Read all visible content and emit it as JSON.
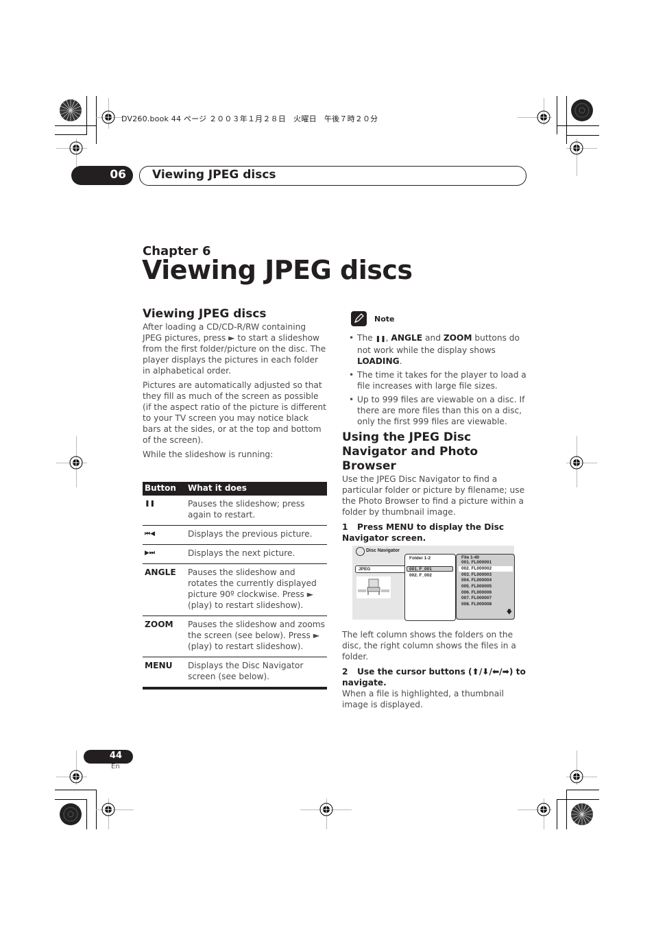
{
  "print_meta": "DV260.book  44 ページ  ２００３年１月２８日　火曜日　午後７時２０分",
  "header": {
    "chapter_number": "06",
    "section_title": "Viewing JPEG discs"
  },
  "chapter_label": "Chapter 6",
  "page_title": "Viewing JPEG discs",
  "left_column": {
    "heading": "Viewing JPEG discs",
    "paragraphs": [
      "After loading a CD/CD-R/RW containing JPEG pictures, press ► to start a slideshow from the first folder/picture on the disc. The player displays the pictures in each folder in alphabetical order.",
      "Pictures are automatically adjusted so that they fill as much of the screen as possible (if the aspect ratio of the picture is different to your TV screen you may notice black bars at the sides, or at the top and bottom of the screen).",
      "While the slideshow is running:"
    ]
  },
  "table": {
    "headers": [
      "Button",
      "What it does"
    ],
    "rows": [
      {
        "button": "❚❚",
        "description": "Pauses the slideshow; press again to restart."
      },
      {
        "button": "⏮◀",
        "description": "Displays the previous picture."
      },
      {
        "button": "▶⏭",
        "description": "Displays the next picture."
      },
      {
        "button": "ANGLE",
        "description": "Pauses the slideshow and rotates the currently displayed picture 90º clockwise. Press ► (play) to restart slideshow)."
      },
      {
        "button": "ZOOM",
        "description": "Pauses the slideshow and zooms the screen (see below). Press ► (play) to restart slideshow)."
      },
      {
        "button": "MENU",
        "description": "Displays the Disc Navigator screen (see below)."
      }
    ]
  },
  "note": {
    "label": "Note",
    "items": [
      {
        "pre": "The ",
        "b1": "❚❚",
        "mid1": ", ",
        "b2": "ANGLE",
        "mid2": " and ",
        "b3": "ZOOM",
        "mid3": " buttons do not work while the display shows ",
        "b4": "LOADING",
        "post": "."
      },
      {
        "text": "The time it takes for the player to load a file increases with large file sizes."
      },
      {
        "text": "Up to 999 files are viewable on a disc. If there are more files than this on a disc, only the first 999 files are viewable."
      }
    ]
  },
  "right_column": {
    "heading": "Using the JPEG Disc Navigator and Photo Browser",
    "intro": "Use the JPEG Disc Navigator to find a particular folder or picture by filename; use the Photo Browser to find a picture within a folder by thumbnail image.",
    "step1_num": "1",
    "step1": "Press MENU to display the Disc Navigator screen.",
    "after_screen": "The left column shows the folders on the disc, the right column shows the files in a folder.",
    "step2_num": "2",
    "step2": "Use the cursor buttons (⬆/⬇/⬅/➡) to navigate.",
    "step2_body": "When a file is highlighted, a thumbnail image is displayed."
  },
  "disc_navigator": {
    "title": "Disc Navigator",
    "left_item": "JPEG",
    "folder_header": "Folder 1-2",
    "folders": [
      "001. F_001",
      "002. F_002"
    ],
    "selected_folder": 0,
    "file_header": "File 1-40",
    "files": [
      "001. FL000001",
      "002. FL000002",
      "003. FL000003",
      "004. FL000004",
      "005. FL000005",
      "006. FL000006",
      "007. FL000007",
      "008. FL000008"
    ],
    "selected_file": 1,
    "scroll_arrow": "🡇"
  },
  "footer": {
    "page_number": "44",
    "language": "En"
  }
}
